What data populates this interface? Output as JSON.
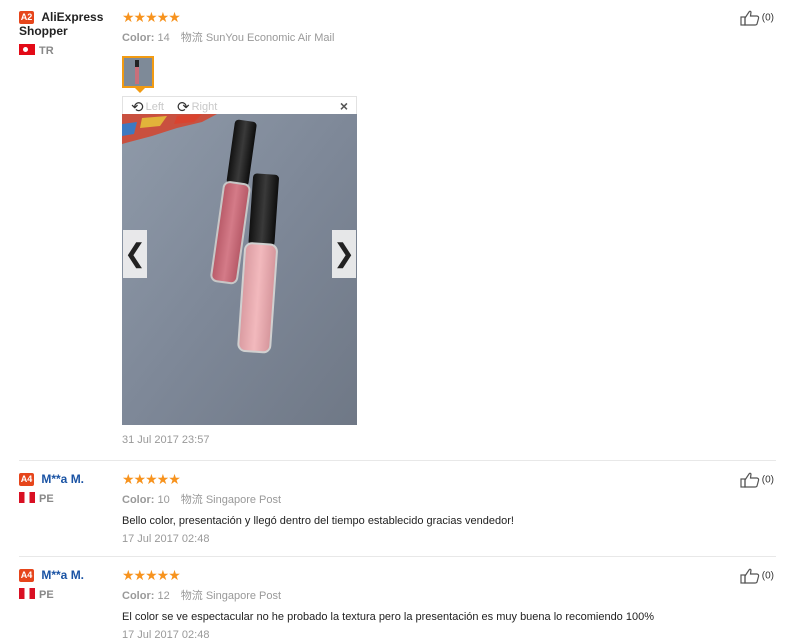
{
  "reviews": [
    {
      "badge": "A2",
      "name_line1": "AliExpress",
      "name_line2": "Shopper",
      "country": "TR",
      "stars": "★★★★★",
      "color_label": "Color:",
      "color_value": "14",
      "shipping": "物流 SunYou Economic Air Mail",
      "date": "31 Jul 2017 23:57",
      "helpful_count": "(0)"
    },
    {
      "badge": "A4",
      "name": "M**a M.",
      "country": "PE",
      "stars": "★★★★★",
      "color_label": "Color:",
      "color_value": "10",
      "shipping": "物流 Singapore Post",
      "text": "Bello color, presentación y llegó dentro del tiempo establecido gracias vendedor!",
      "date": "17 Jul 2017 02:48",
      "helpful_count": "(0)"
    },
    {
      "badge": "A4",
      "name": "M**a M.",
      "country": "PE",
      "stars": "★★★★★",
      "color_label": "Color:",
      "color_value": "12",
      "shipping": "物流 Singapore Post",
      "text": "El color se ve espectacular no he probado la textura pero la presentación es muy buena lo recomiendo 100%",
      "date": "17 Jul 2017 02:48",
      "helpful_count": "(0)"
    }
  ],
  "viewer": {
    "rotate_left": "Left",
    "rotate_right": "Right",
    "close": "×",
    "prev": "❮",
    "next": "❯"
  },
  "colors": {
    "star": "#f7931e",
    "badge": "#e6451b",
    "link_name": "#1a53a4",
    "thumb_border": "#f29b12"
  }
}
